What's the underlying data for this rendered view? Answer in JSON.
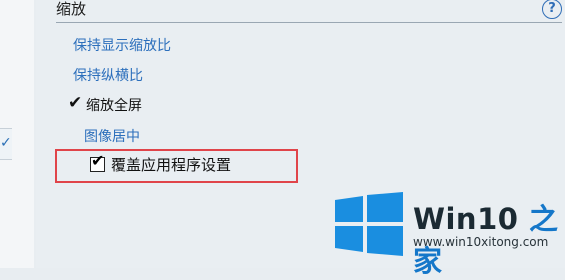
{
  "section": {
    "title": "缩放",
    "help_icon": "help-circle-icon"
  },
  "options": [
    {
      "label": "保持显示缩放比",
      "selected": false
    },
    {
      "label": "保持纵横比",
      "selected": false
    },
    {
      "label": "缩放全屏",
      "selected": true
    },
    {
      "label": "图像居中",
      "selected": false
    }
  ],
  "override": {
    "label": "覆盖应用程序设置",
    "checked": true
  },
  "watermark": {
    "brand_main": "Win10 ",
    "brand_accent": "之家",
    "url": "www.win10xitong.com"
  },
  "colors": {
    "link_blue": "#2c6fbc",
    "highlight_red": "#e0444a",
    "background": "#e9eef2"
  }
}
